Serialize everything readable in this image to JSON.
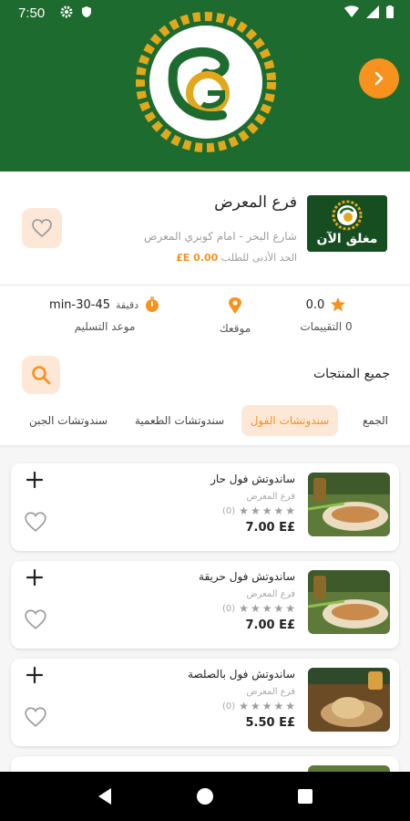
{
  "status_bar": {
    "time": "7:50"
  },
  "brand": {
    "primary_color": "#1d6b2f",
    "accent_color": "#f7921e",
    "logo_name": "restaurant-logo"
  },
  "branch": {
    "name": "فرع المعرض",
    "address": "شارع البحر - امام كوبري المعرض",
    "min_order_label": "الحد الأدنى للطلب",
    "min_order_value": "0.00 E£",
    "closed_label": "مغلق الآن"
  },
  "stats": {
    "rating_value": "0.0",
    "rating_label": "0 التقييمات",
    "location_label": "موقعك",
    "delivery_value": "30-45-min",
    "delivery_unit": "دقيقة",
    "delivery_label": "موعد التسليم"
  },
  "products_section": {
    "title": "جميع المنتجات",
    "tabs": [
      {
        "label": "الجمع",
        "active": false
      },
      {
        "label": "سندوتشات الفول",
        "active": true
      },
      {
        "label": "سندوتشات الطعمية",
        "active": false
      },
      {
        "label": "سندوتشات الجبن",
        "active": false
      }
    ]
  },
  "products": [
    {
      "name": "ساندوتش فول حار",
      "branch": "فرع المعرض",
      "rating_count": "(0)",
      "price": "7.00 E£"
    },
    {
      "name": "ساندوتش فول حريقة",
      "branch": "فرع المعرض",
      "rating_count": "(0)",
      "price": "7.00 E£"
    },
    {
      "name": "ساندوتش فول بالصلصة",
      "branch": "فرع المعرض",
      "rating_count": "(0)",
      "price": "5.50 E£"
    }
  ]
}
